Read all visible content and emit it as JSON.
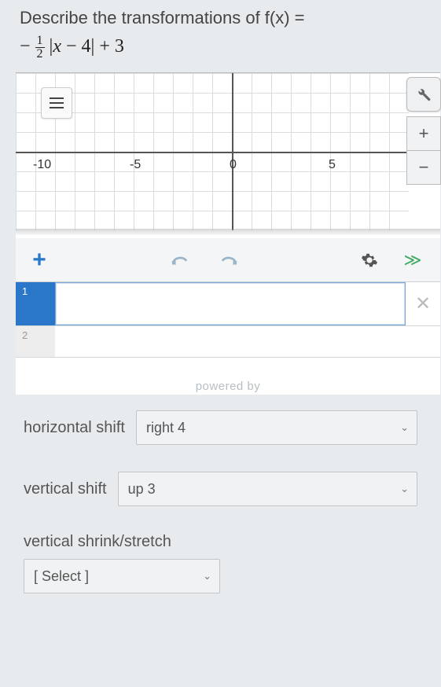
{
  "question": {
    "prompt": "Describe the transformations of f(x) =",
    "formula_prefix": "−",
    "frac_num": "1",
    "frac_den": "2",
    "formula_body": "|x − 4| + 3"
  },
  "graph": {
    "ticks": {
      "neg10": "-10",
      "neg5": "-5",
      "zero": "0",
      "pos5": "5"
    },
    "tools": {
      "wrench": "🔧",
      "plus": "+",
      "minus": "−"
    },
    "toolbar": {
      "add": "+",
      "undo": "↶",
      "redo": "↷",
      "gear": "✿",
      "collapse": "≫"
    },
    "rows": {
      "r1": "1",
      "r2": "2",
      "close": "✕"
    },
    "powered": "powered by"
  },
  "controls": {
    "hshift_label": "horizontal shift",
    "hshift_value": "right 4",
    "vshift_label": "vertical shift",
    "vshift_value": "up 3",
    "vstretch_label": "vertical shrink/stretch",
    "vstretch_value": "[ Select ]"
  }
}
